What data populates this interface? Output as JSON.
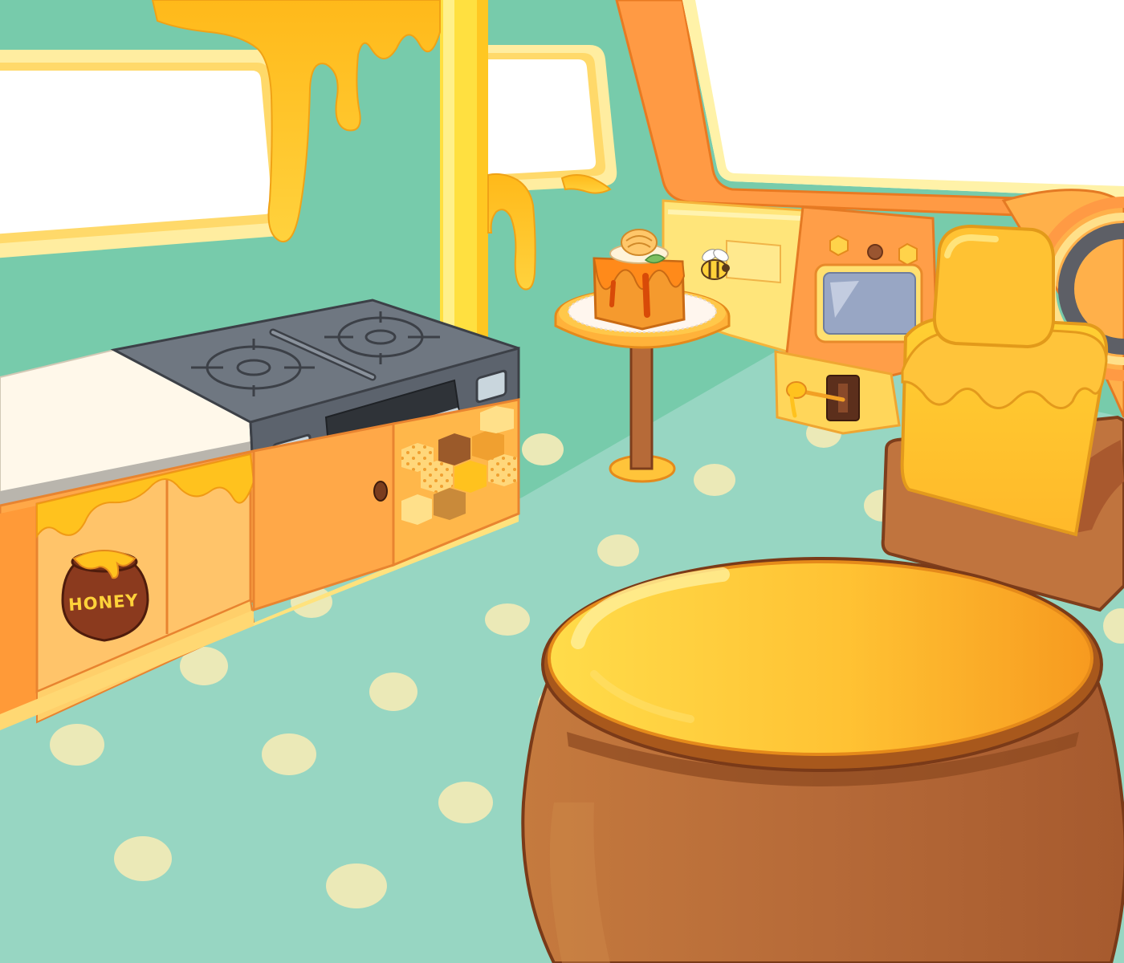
{
  "scene": {
    "honey_jar_label": "HONEY"
  },
  "colors": {
    "wall": "#77cbab",
    "floor": "#97d6c2",
    "floor_dot": "#ebe9b7",
    "honey": "#ffc21e",
    "honey_dark": "#f29a12",
    "orange_trim": "#ff9a44",
    "cream": "#fff5b8",
    "stove_metal": "#6f7781",
    "pot_brown": "#b66a38",
    "seat_brown": "#b6673a"
  },
  "icons": [
    "bee-icon",
    "honey-dipper-icon",
    "knob-icon",
    "hexagon-icon"
  ]
}
